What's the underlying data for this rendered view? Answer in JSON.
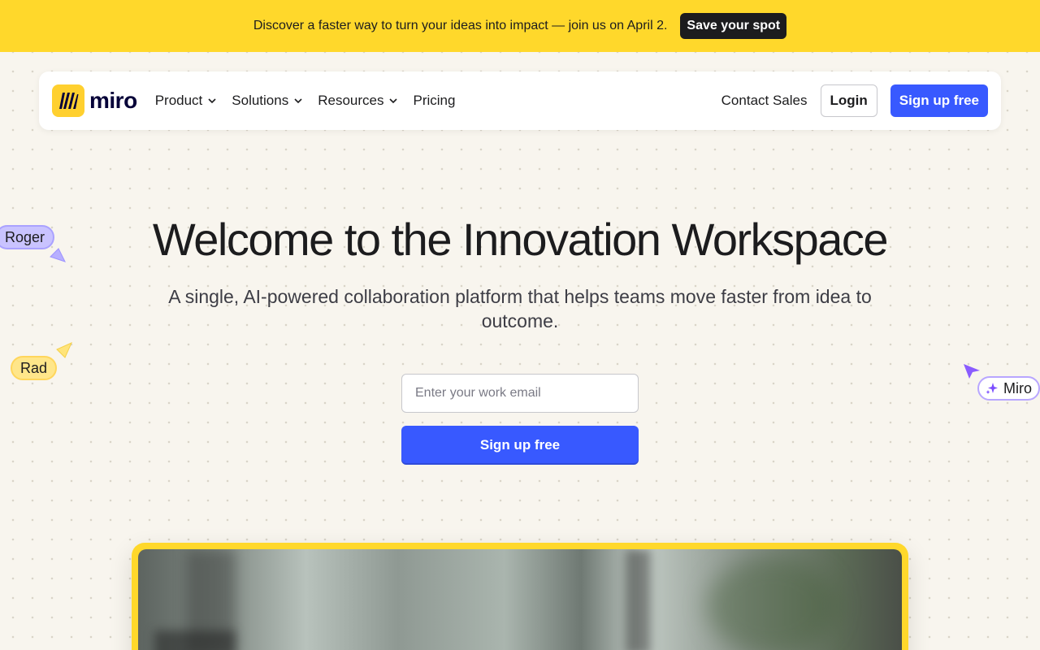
{
  "banner": {
    "text": "Discover a faster way to turn your ideas into impact — join us on April 2.",
    "cta_label": "Save your spot"
  },
  "nav": {
    "logo_text": "miro",
    "items": [
      {
        "label": "Product",
        "has_dropdown": true
      },
      {
        "label": "Solutions",
        "has_dropdown": true
      },
      {
        "label": "Resources",
        "has_dropdown": true
      },
      {
        "label": "Pricing",
        "has_dropdown": false
      }
    ],
    "contact_label": "Contact Sales",
    "login_label": "Login",
    "signup_label": "Sign up free"
  },
  "hero": {
    "title": "Welcome to the Innovation Workspace",
    "subtitle": "A single, AI-powered collaboration platform that helps teams move faster from idea to outcome.",
    "email_placeholder": "Enter your work email",
    "signup_label": "Sign up free"
  },
  "cursor_tags": {
    "roger": "Roger",
    "rad": "Rad",
    "miro": "Miro"
  },
  "colors": {
    "banner_bg": "#ffd82b",
    "primary_blue": "#3859ff",
    "page_bg": "#f8f5ee",
    "logo_yellow": "#ffd02f"
  },
  "icons": {
    "logo": "miro-logo-icon",
    "dropdown": "chevron-down-icon",
    "ai_sparkle": "sparkle-icon",
    "cursor": "cursor-arrow-icon"
  }
}
